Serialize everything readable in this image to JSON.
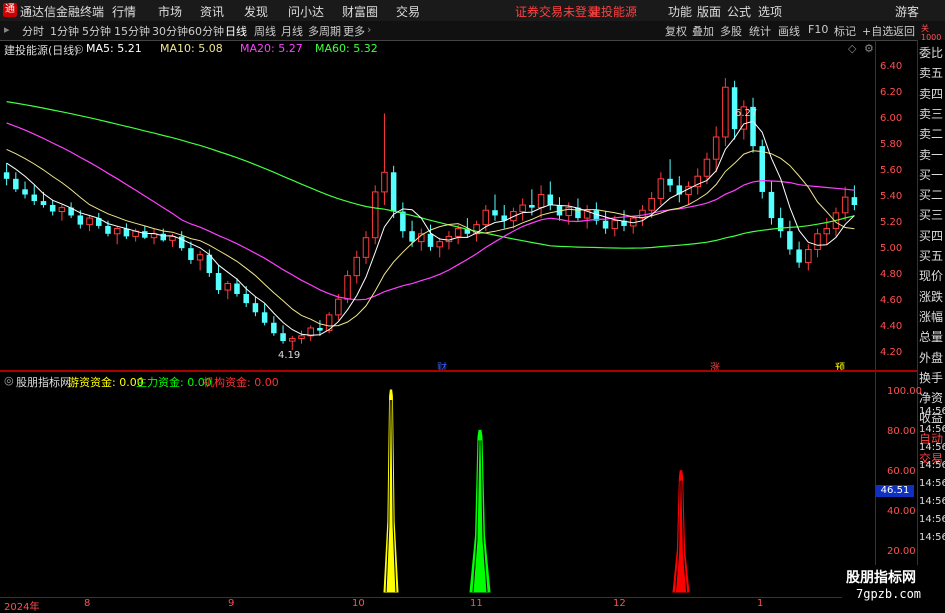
{
  "titlebar": {
    "logo": "通",
    "app_name": "通达信金融终端",
    "menus": [
      "行情",
      "市场",
      "资讯",
      "发现",
      "问小达",
      "财富圈",
      "交易"
    ],
    "login_notice": "证券交易未登录",
    "stock_name": "建投能源",
    "right_menus": [
      "功能",
      "版面",
      "公式",
      "选项"
    ],
    "guest": "游客"
  },
  "toolbar": {
    "periods": [
      "分时",
      "1分钟",
      "5分钟",
      "15分钟",
      "30分钟",
      "60分钟",
      "日线",
      "周线",
      "月线",
      "多周期",
      "更多"
    ],
    "active": "日线",
    "right": [
      "复权",
      "叠加",
      "多股",
      "统计",
      "画线",
      "F10",
      "标记",
      "+自选",
      "返回"
    ]
  },
  "main_legend": {
    "title": "建投能源(日线)",
    "ma5": "MA5: 5.21",
    "ma10": "MA10: 5.08",
    "ma20": "MA20: 5.27",
    "ma60": "MA60: 5.32"
  },
  "colors": {
    "up": "#ff3c3c",
    "down": "#54ffff",
    "ma5": "#ffffff",
    "ma10": "#f0e68c",
    "ma20": "#ff40ff",
    "ma60": "#40ff40",
    "axis": "#ff5050",
    "yellow": "#ffff00",
    "green": "#00ff00",
    "red": "#ff0000"
  },
  "price_axis": [
    "6.40",
    "6.20",
    "6.00",
    "5.80",
    "5.60",
    "5.40",
    "5.20",
    "5.00",
    "4.80",
    "4.60",
    "4.40",
    "4.20"
  ],
  "annotations": {
    "high": "6.27",
    "low": "4.19",
    "marker_cai": "财",
    "marker_zhang": "涨",
    "marker_yu": "预"
  },
  "side_panel": [
    "委比",
    "卖五",
    "卖四",
    "卖三",
    "卖二",
    "卖一",
    "买一",
    "买二",
    "买三",
    "买四",
    "买五",
    "现价",
    "涨跌",
    "涨幅",
    "总量",
    "外盘",
    "换手",
    "净资",
    "收益",
    "自动",
    "交易"
  ],
  "side_corner": [
    "关",
    "1000"
  ],
  "sub_legend": {
    "title": "股朋指标网",
    "youzi": "游资资金: 0.00",
    "zhuli": "主力资金: 0.00",
    "jigou": "机构资金: 0.00"
  },
  "sub_axis": [
    "100.00",
    "80.00",
    "60.00",
    "40.00",
    "20.00"
  ],
  "sub_cursor": "46.51",
  "time_list": [
    "14:56",
    "14:56",
    "14:56",
    "14:56",
    "14:56",
    "14:56",
    "14:56",
    "14:56"
  ],
  "time_axis": [
    "2024年",
    "8",
    "9",
    "10",
    "11",
    "12",
    "1"
  ],
  "watermark": {
    "line1": "股朋指标网",
    "line2": "7gpzb.com"
  },
  "chart_data": {
    "type": "candlestick",
    "ylim": [
      4.1,
      6.5
    ],
    "ma_last": {
      "MA5": 5.21,
      "MA10": 5.08,
      "MA20": 5.27,
      "MA60": 5.32
    },
    "ohlc": [
      [
        5.55,
        5.62,
        5.45,
        5.5
      ],
      [
        5.5,
        5.55,
        5.4,
        5.42
      ],
      [
        5.42,
        5.48,
        5.35,
        5.38
      ],
      [
        5.38,
        5.45,
        5.3,
        5.33
      ],
      [
        5.33,
        5.4,
        5.28,
        5.3
      ],
      [
        5.3,
        5.34,
        5.22,
        5.25
      ],
      [
        5.25,
        5.3,
        5.18,
        5.28
      ],
      [
        5.28,
        5.32,
        5.2,
        5.22
      ],
      [
        5.22,
        5.26,
        5.12,
        5.15
      ],
      [
        5.15,
        5.22,
        5.1,
        5.2
      ],
      [
        5.2,
        5.24,
        5.12,
        5.14
      ],
      [
        5.14,
        5.18,
        5.06,
        5.08
      ],
      [
        5.08,
        5.14,
        5.0,
        5.12
      ],
      [
        5.12,
        5.16,
        5.04,
        5.06
      ],
      [
        5.06,
        5.12,
        5.02,
        5.1
      ],
      [
        5.1,
        5.14,
        5.04,
        5.05
      ],
      [
        5.05,
        5.12,
        5.0,
        5.08
      ],
      [
        5.08,
        5.12,
        5.02,
        5.03
      ],
      [
        5.03,
        5.08,
        4.98,
        5.06
      ],
      [
        5.06,
        5.1,
        4.95,
        4.97
      ],
      [
        4.97,
        5.02,
        4.85,
        4.88
      ],
      [
        4.88,
        4.95,
        4.8,
        4.92
      ],
      [
        4.92,
        4.96,
        4.75,
        4.78
      ],
      [
        4.78,
        4.84,
        4.62,
        4.65
      ],
      [
        4.65,
        4.72,
        4.58,
        4.7
      ],
      [
        4.7,
        4.74,
        4.6,
        4.62
      ],
      [
        4.62,
        4.68,
        4.52,
        4.55
      ],
      [
        4.55,
        4.6,
        4.45,
        4.48
      ],
      [
        4.48,
        4.55,
        4.38,
        4.4
      ],
      [
        4.4,
        4.45,
        4.3,
        4.32
      ],
      [
        4.32,
        4.38,
        4.24,
        4.26
      ],
      [
        4.26,
        4.3,
        4.19,
        4.28
      ],
      [
        4.28,
        4.34,
        4.24,
        4.3
      ],
      [
        4.3,
        4.38,
        4.26,
        4.36
      ],
      [
        4.36,
        4.42,
        4.3,
        4.34
      ],
      [
        4.34,
        4.48,
        4.32,
        4.46
      ],
      [
        4.46,
        4.62,
        4.42,
        4.58
      ],
      [
        4.58,
        4.8,
        4.55,
        4.76
      ],
      [
        4.76,
        4.95,
        4.7,
        4.9
      ],
      [
        4.9,
        5.1,
        4.85,
        5.05
      ],
      [
        5.05,
        5.45,
        5.0,
        5.4
      ],
      [
        5.4,
        6.0,
        5.3,
        5.55
      ],
      [
        5.55,
        5.6,
        5.2,
        5.25
      ],
      [
        5.25,
        5.32,
        5.05,
        5.1
      ],
      [
        5.1,
        5.18,
        4.98,
        5.02
      ],
      [
        5.02,
        5.12,
        4.95,
        5.08
      ],
      [
        5.08,
        5.15,
        4.95,
        4.98
      ],
      [
        4.98,
        5.05,
        4.9,
        5.02
      ],
      [
        5.02,
        5.1,
        4.96,
        5.06
      ],
      [
        5.06,
        5.15,
        5.0,
        5.12
      ],
      [
        5.12,
        5.2,
        5.05,
        5.08
      ],
      [
        5.08,
        5.18,
        5.02,
        5.15
      ],
      [
        5.15,
        5.3,
        5.1,
        5.26
      ],
      [
        5.26,
        5.38,
        5.18,
        5.22
      ],
      [
        5.22,
        5.3,
        5.12,
        5.18
      ],
      [
        5.18,
        5.28,
        5.12,
        5.25
      ],
      [
        5.25,
        5.35,
        5.18,
        5.3
      ],
      [
        5.3,
        5.42,
        5.22,
        5.28
      ],
      [
        5.28,
        5.45,
        5.2,
        5.38
      ],
      [
        5.38,
        5.48,
        5.26,
        5.3
      ],
      [
        5.3,
        5.36,
        5.18,
        5.22
      ],
      [
        5.22,
        5.32,
        5.15,
        5.28
      ],
      [
        5.28,
        5.35,
        5.18,
        5.2
      ],
      [
        5.2,
        5.3,
        5.12,
        5.26
      ],
      [
        5.26,
        5.32,
        5.15,
        5.18
      ],
      [
        5.18,
        5.25,
        5.08,
        5.12
      ],
      [
        5.12,
        5.22,
        5.06,
        5.18
      ],
      [
        5.18,
        5.26,
        5.1,
        5.14
      ],
      [
        5.14,
        5.22,
        5.08,
        5.2
      ],
      [
        5.2,
        5.3,
        5.14,
        5.26
      ],
      [
        5.26,
        5.4,
        5.2,
        5.35
      ],
      [
        5.35,
        5.55,
        5.3,
        5.5
      ],
      [
        5.5,
        5.65,
        5.4,
        5.45
      ],
      [
        5.45,
        5.52,
        5.32,
        5.38
      ],
      [
        5.38,
        5.48,
        5.3,
        5.44
      ],
      [
        5.44,
        5.58,
        5.38,
        5.52
      ],
      [
        5.52,
        5.7,
        5.46,
        5.65
      ],
      [
        5.65,
        5.9,
        5.55,
        5.82
      ],
      [
        5.82,
        6.27,
        5.75,
        6.2
      ],
      [
        6.2,
        6.25,
        5.8,
        5.88
      ],
      [
        5.88,
        6.1,
        5.8,
        6.05
      ],
      [
        6.05,
        6.12,
        5.7,
        5.75
      ],
      [
        5.75,
        5.8,
        5.35,
        5.4
      ],
      [
        5.4,
        5.48,
        5.15,
        5.2
      ],
      [
        5.2,
        5.28,
        5.05,
        5.1
      ],
      [
        5.1,
        5.18,
        4.92,
        4.96
      ],
      [
        4.96,
        5.02,
        4.82,
        4.86
      ],
      [
        4.86,
        5.0,
        4.8,
        4.96
      ],
      [
        4.96,
        5.12,
        4.9,
        5.08
      ],
      [
        5.08,
        5.2,
        5.0,
        5.12
      ],
      [
        5.12,
        5.28,
        5.06,
        5.24
      ],
      [
        5.24,
        5.44,
        5.18,
        5.36
      ],
      [
        5.36,
        5.45,
        5.26,
        5.3
      ]
    ],
    "series_subchart": [
      {
        "name": "游资资金",
        "peak": 100
      },
      {
        "name": "主力资金",
        "peak": 80
      },
      {
        "name": "机构资金",
        "peak": 60
      }
    ]
  }
}
